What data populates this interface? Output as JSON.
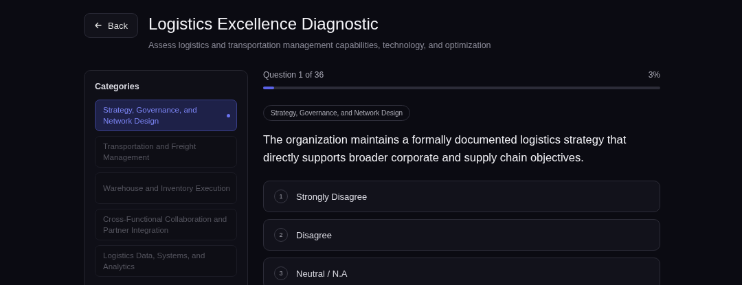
{
  "header": {
    "back_label": "Back",
    "title": "Logistics Excellence Diagnostic",
    "subtitle": "Assess logistics and transportation management capabilities, technology, and optimization"
  },
  "sidebar": {
    "title": "Categories",
    "items": [
      {
        "label": "Strategy, Governance, and Network Design",
        "selected": true
      },
      {
        "label": "Transportation and Freight Management",
        "selected": false
      },
      {
        "label": "Warehouse and Inventory Execution",
        "selected": false
      },
      {
        "label": "Cross-Functional Collaboration and Partner Integration",
        "selected": false
      },
      {
        "label": "Logistics Data, Systems, and Analytics",
        "selected": false
      }
    ]
  },
  "progress": {
    "label": "Question 1 of 36",
    "percent": "3%",
    "level": 0.028
  },
  "question": {
    "category_tag": "Strategy, Governance, and Network Design",
    "text": "The organization maintains a formally documented logistics strategy that directly supports broader corporate and supply chain objectives.",
    "options": [
      {
        "number": "1",
        "label": "Strongly Disagree",
        "selected": false
      },
      {
        "number": "2",
        "label": "Disagree",
        "selected": false
      },
      {
        "number": "3",
        "label": "Neutral / N.A",
        "selected": false
      }
    ]
  }
}
